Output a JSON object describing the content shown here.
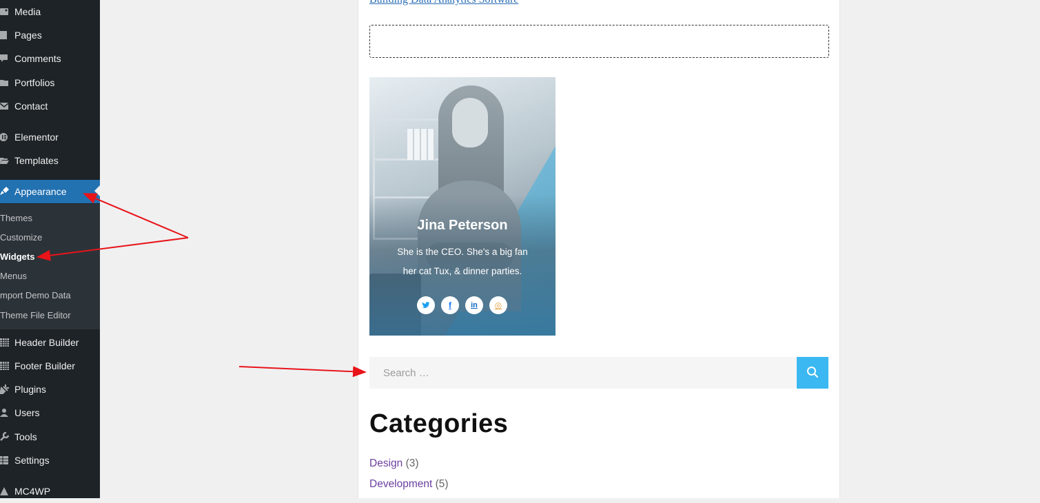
{
  "sidebar": {
    "items": [
      {
        "label": "Media",
        "icon": "media-icon"
      },
      {
        "label": "Pages",
        "icon": "pages-icon"
      },
      {
        "label": "Comments",
        "icon": "comments-icon"
      },
      {
        "label": "Portfolios",
        "icon": "folder-icon"
      },
      {
        "label": "Contact",
        "icon": "mail-icon"
      },
      {
        "label": "Elementor",
        "icon": "elementor-icon"
      },
      {
        "label": "Templates",
        "icon": "folder-open-icon"
      },
      {
        "label": "Appearance",
        "icon": "paintbrush-icon",
        "current": true
      },
      {
        "label": "Header Builder",
        "icon": "grid-icon"
      },
      {
        "label": "Footer Builder",
        "icon": "grid-icon"
      },
      {
        "label": "Plugins",
        "icon": "plug-icon"
      },
      {
        "label": "Users",
        "icon": "user-icon"
      },
      {
        "label": "Tools",
        "icon": "wrench-icon"
      },
      {
        "label": "Settings",
        "icon": "settings-icon"
      },
      {
        "label": "MC4WP",
        "icon": "mc4wp-icon"
      }
    ],
    "submenu": [
      {
        "label": "Themes"
      },
      {
        "label": "Customize"
      },
      {
        "label": "Widgets",
        "current": true
      },
      {
        "label": "Menus"
      },
      {
        "label": "mport Demo Data"
      },
      {
        "label": "Theme File Editor"
      }
    ]
  },
  "content": {
    "top_link": "Building Data Analytics Software",
    "profile": {
      "name": "Jina Peterson",
      "bio": "She is the CEO. She's a big fan her cat Tux, & dinner parties.",
      "socials": [
        {
          "name": "twitter-icon",
          "glyph": "t",
          "color": "#1da1f2"
        },
        {
          "name": "facebook-icon",
          "glyph": "f",
          "color": "#1877f2"
        },
        {
          "name": "linkedin-icon",
          "glyph": "in",
          "color": "#0a66c2"
        },
        {
          "name": "instagram-icon",
          "glyph": "◎",
          "color": "#e2a03f"
        }
      ]
    },
    "search": {
      "placeholder": "Search …",
      "value": ""
    },
    "categories": {
      "title": "Categories",
      "items": [
        {
          "label": "Design",
          "count": "(3)"
        },
        {
          "label": "Development",
          "count": "(5)"
        }
      ]
    }
  },
  "colors": {
    "sidebar_bg": "#1d2327",
    "current_menu": "#2271b1",
    "search_button": "#3bb8f2",
    "annotation_arrow": "#e8141a",
    "category_link": "#6b3fa0"
  }
}
